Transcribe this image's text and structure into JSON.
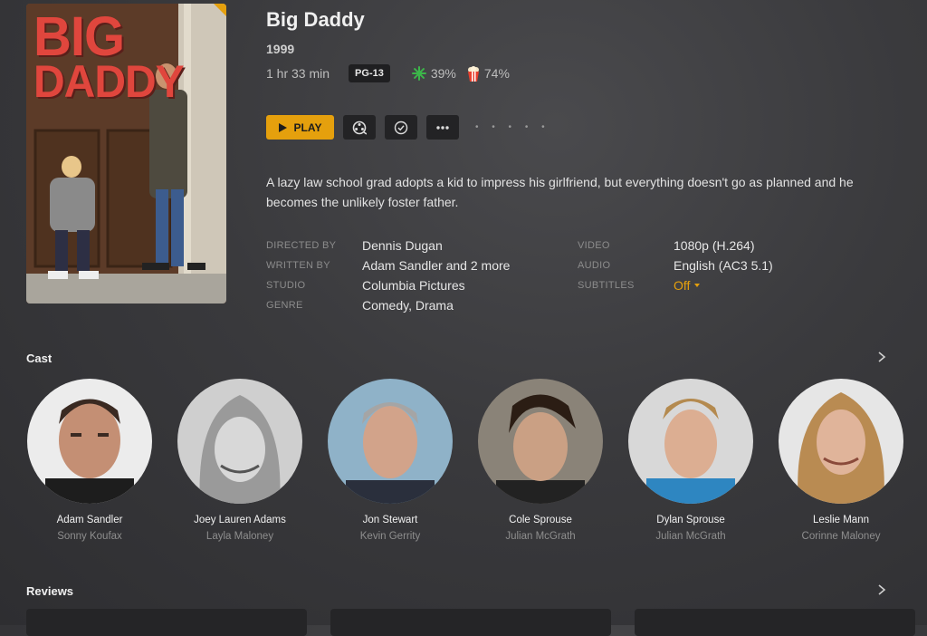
{
  "movie": {
    "title": "Big Daddy",
    "poster_title_line1": "BIG",
    "poster_title_line2": "DADDY",
    "year": "1999",
    "duration": "1 hr 33 min",
    "content_rating": "PG-13",
    "critic_score": "39%",
    "audience_score": "74%",
    "summary": "A lazy law school grad adopts a kid to impress his girlfriend, but everything doesn't go as planned and he becomes the unlikely foster father."
  },
  "actions": {
    "play_label": "PLAY",
    "more_dots": "• • • • •"
  },
  "details": {
    "directed_by_label": "DIRECTED BY",
    "directed_by": "Dennis Dugan",
    "written_by_label": "WRITTEN BY",
    "written_by": "Adam Sandler  and 2 more",
    "studio_label": "STUDIO",
    "studio": "Columbia Pictures",
    "genre_label": "GENRE",
    "genre": "Comedy, Drama",
    "video_label": "VIDEO",
    "video": "1080p (H.264)",
    "audio_label": "AUDIO",
    "audio": "English (AC3 5.1)",
    "subtitles_label": "SUBTITLES",
    "subtitles": "Off"
  },
  "sections": {
    "cast_title": "Cast",
    "reviews_title": "Reviews"
  },
  "cast": [
    {
      "name": "Adam Sandler",
      "role": "Sonny Koufax"
    },
    {
      "name": "Joey Lauren Adams",
      "role": "Layla Maloney"
    },
    {
      "name": "Jon Stewart",
      "role": "Kevin Gerrity"
    },
    {
      "name": "Cole Sprouse",
      "role": "Julian McGrath"
    },
    {
      "name": "Dylan Sprouse",
      "role": "Julian McGrath"
    },
    {
      "name": "Leslie Mann",
      "role": "Corinne Maloney"
    }
  ],
  "colors": {
    "accent": "#e5a00d",
    "critic_icon": "#3cb54a",
    "audience_icon": "#e8402e"
  },
  "icons": {
    "play": "play-icon",
    "trailer": "film-reel-icon",
    "watched": "check-circle-icon",
    "more": "more-icon",
    "critic": "splat-icon",
    "audience": "popcorn-icon",
    "next": "chevron-right-icon"
  }
}
